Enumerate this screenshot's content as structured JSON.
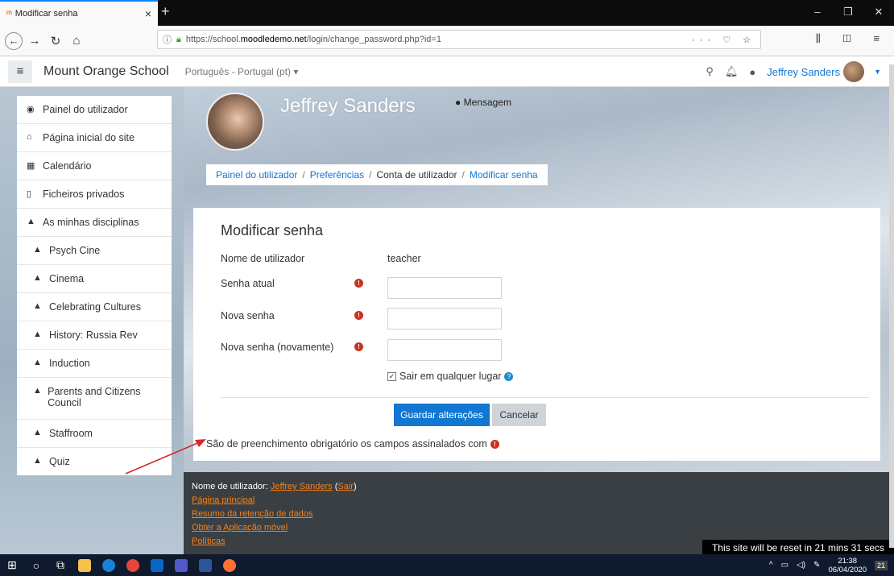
{
  "browser": {
    "tab_title": "Modificar senha",
    "tab_favicon": "moodle-favicon",
    "url_prefix": "https://school.",
    "url_host": "moodledemo.net",
    "url_path": "/login/change_password.php?id=1",
    "url_actions": "··· ♡ ☆"
  },
  "header": {
    "site_name": "Mount Orange School",
    "language": "Português - Portugal (pt) ▾",
    "user_name": "Jeffrey Sanders"
  },
  "sidebar": {
    "items": [
      {
        "label": "Painel do utilizador",
        "icon": "dashboard-icon"
      },
      {
        "label": "Página inicial do site",
        "icon": "home-icon"
      },
      {
        "label": "Calendário",
        "icon": "calendar-icon"
      },
      {
        "label": "Ficheiros privados",
        "icon": "file-icon"
      },
      {
        "label": "As minhas disciplinas",
        "icon": "graduation-cap-icon"
      },
      {
        "label": "Psych Cine",
        "icon": "graduation-cap-icon"
      },
      {
        "label": "Cinema",
        "icon": "graduation-cap-icon"
      },
      {
        "label": "Celebrating Cultures",
        "icon": "graduation-cap-icon"
      },
      {
        "label": "History: Russia Rev",
        "icon": "graduation-cap-icon"
      },
      {
        "label": "Induction",
        "icon": "graduation-cap-icon"
      },
      {
        "label": "Parents and Citizens Council",
        "icon": "graduation-cap-icon"
      },
      {
        "label": "Staffroom",
        "icon": "graduation-cap-icon"
      },
      {
        "label": "Quiz",
        "icon": "graduation-cap-icon"
      }
    ]
  },
  "profile": {
    "name": "Jeffrey Sanders",
    "message_label": "Mensagem"
  },
  "breadcrumb": {
    "items": [
      "Painel do utilizador",
      "Preferências",
      "Conta de utilizador",
      "Modificar senha"
    ],
    "separator": "/"
  },
  "form": {
    "title": "Modificar senha",
    "username_label": "Nome de utilizador",
    "username_value": "teacher",
    "current_password_label": "Senha atual",
    "new_password_label": "Nova senha",
    "new_password_again_label": "Nova senha (novamente)",
    "logout_label": "Sair em qualquer lugar",
    "logout_checked": true,
    "save_label": "Guardar alterações",
    "cancel_label": "Cancelar",
    "required_note": "São de preenchimento obrigatório os campos assinalados com"
  },
  "footer": {
    "user_prefix": "Nome de utilizador: ",
    "user_name": "Jeffrey Sanders",
    "logout": "Sair",
    "links": [
      "Página principal",
      "Resumo da retenção de dados",
      "Obter a Aplicação móvel",
      "Políticas"
    ],
    "reset_notice": "This site will be reset in 21 mins 31 secs"
  },
  "taskbar": {
    "time": "21:38",
    "date": "06/04/2020",
    "notifications": "21"
  },
  "colors": {
    "accent": "#1177d1",
    "required": "#ca3120",
    "footer_link": "#f98012"
  }
}
